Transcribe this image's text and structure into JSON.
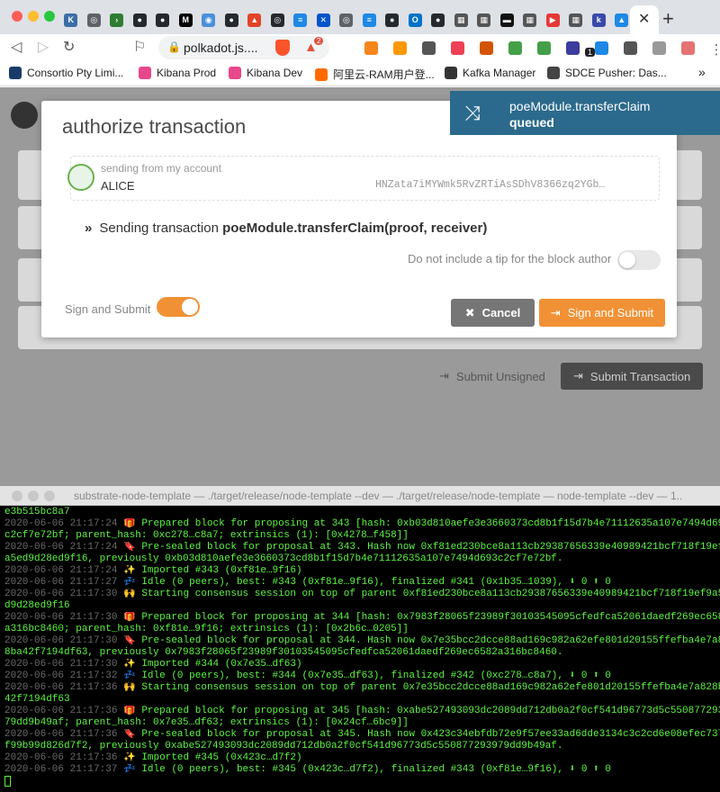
{
  "browser": {
    "tab_icons": [
      {
        "name": "tab-favicon-1",
        "color": "#3b6ea5",
        "glyph": "K"
      },
      {
        "name": "tab-favicon-2",
        "color": "#5f6368",
        "glyph": "◎"
      },
      {
        "name": "tab-favicon-3",
        "color": "#2e7d32",
        "glyph": "›"
      },
      {
        "name": "tab-favicon-4",
        "color": "#24292e",
        "glyph": "●"
      },
      {
        "name": "tab-favicon-5",
        "color": "#24292e",
        "glyph": "●"
      },
      {
        "name": "tab-favicon-6",
        "color": "#000000",
        "glyph": "M"
      },
      {
        "name": "tab-favicon-7",
        "color": "#4a90d9",
        "glyph": "◉"
      },
      {
        "name": "tab-favicon-8",
        "color": "#24292e",
        "glyph": "●"
      },
      {
        "name": "tab-favicon-9",
        "color": "#e24329",
        "glyph": "▲"
      },
      {
        "name": "tab-favicon-10",
        "color": "#24292e",
        "glyph": "◎"
      },
      {
        "name": "tab-favicon-11",
        "color": "#1e88e5",
        "glyph": "≡"
      },
      {
        "name": "tab-favicon-12",
        "color": "#0052cc",
        "glyph": "✕"
      },
      {
        "name": "tab-favicon-13",
        "color": "#5f6368",
        "glyph": "◎"
      },
      {
        "name": "tab-favicon-14",
        "color": "#1e88e5",
        "glyph": "≡"
      },
      {
        "name": "tab-favicon-15",
        "color": "#24292e",
        "glyph": "●"
      },
      {
        "name": "tab-favicon-16",
        "color": "#0072c6",
        "glyph": "O"
      },
      {
        "name": "tab-favicon-17",
        "color": "#24292e",
        "glyph": "●"
      },
      {
        "name": "tab-favicon-18",
        "color": "#555555",
        "glyph": "▦"
      },
      {
        "name": "tab-favicon-19",
        "color": "#555555",
        "glyph": "▦"
      },
      {
        "name": "tab-favicon-20",
        "color": "#111111",
        "glyph": "▬"
      },
      {
        "name": "tab-favicon-21",
        "color": "#555555",
        "glyph": "▦"
      },
      {
        "name": "tab-favicon-22",
        "color": "#e53935",
        "glyph": "▶"
      },
      {
        "name": "tab-favicon-23",
        "color": "#555555",
        "glyph": "▦"
      },
      {
        "name": "tab-favicon-24",
        "color": "#3949ab",
        "glyph": "k"
      },
      {
        "name": "tab-favicon-25",
        "color": "#1e88e5",
        "glyph": "▲"
      }
    ],
    "url": "polkadot.js....",
    "extensions": [
      {
        "name": "metamask-icon",
        "color": "#f6851b"
      },
      {
        "name": "rss-icon",
        "color": "#ff9800"
      },
      {
        "name": "eyedropper-icon",
        "color": "#555555"
      },
      {
        "name": "pocket-icon",
        "color": "#ef4056"
      },
      {
        "name": "ni-icon",
        "color": "#d35400"
      },
      {
        "name": "shield-icon",
        "color": "#43a047"
      },
      {
        "name": "refresh-icon",
        "color": "#43a047"
      },
      {
        "name": "ethereum-icon",
        "color": "#3c3c9c"
      },
      {
        "name": "polkadot-ext-icon",
        "color": "#1e88e5"
      },
      {
        "name": "s-icon",
        "color": "#555555"
      },
      {
        "name": "circle-icon",
        "color": "#999999"
      },
      {
        "name": "record-icon",
        "color": "#e57373"
      },
      {
        "name": "menu-dots-icon",
        "color": "#555555"
      }
    ],
    "badge_count": "1",
    "brave_badge": "2",
    "bookmarks": [
      {
        "label": "Consortio Pty Limi...",
        "color": "#1a3a6a"
      },
      {
        "label": "Kibana Prod",
        "color": "#e8478b"
      },
      {
        "label": "Kibana Dev",
        "color": "#e8478b"
      },
      {
        "label": "阿里云-RAM用户登...",
        "color": "#ff6a00"
      },
      {
        "label": "Kafka Manager",
        "color": "#333333"
      },
      {
        "label": "SDCE Pusher: Das...",
        "color": "#444444"
      }
    ],
    "more_bookmarks": "»"
  },
  "modal": {
    "title": "authorize transaction",
    "account_label": "sending from my account",
    "account_name": "ALICE",
    "account_address": "HNZata7iMYWmk5RvZRTiAsSDhV8366zq2YGb…",
    "sending_prefix": "Sending transaction ",
    "sending_call": "poeModule.transferClaim(proof, receiver)",
    "tip_label": "Do not include a tip for the block author",
    "sign_label": "Sign and Submit",
    "cancel_label": "Cancel",
    "sign_submit_label": "Sign and Submit"
  },
  "status": {
    "method": "poeModule.transferClaim",
    "state": "queued"
  },
  "page": {
    "submit_unsigned": "Submit Unsigned",
    "submit_transaction": "Submit Transaction"
  },
  "terminal": {
    "title": "substrate-node-template — ./target/release/node-template --dev — ./target/release/node-template — node-template --dev — 1..",
    "lines": [
      {
        "ts": "",
        "text": "e3b515bc8a7"
      },
      {
        "ts": "2020-06-06 21:17:24 ",
        "text": "🎁 Prepared block for proposing at 343 [hash: 0xb03d810aefe3e3660373cd8b1f15d7b4e71112635a107e7494d693"
      },
      {
        "ts": "",
        "text": "c2cf7e72bf; parent_hash: 0xc278…c8a7; extrinsics (1): [0x4278…f458]]"
      },
      {
        "ts": "2020-06-06 21:17:24 ",
        "text": "🔖 Pre-sealed block for proposal at 343. Hash now 0xf81ed230bce8a113cb29387656339e40989421bcf718f19ef9"
      },
      {
        "ts": "",
        "text": "a5ed9d28ed9f16, previously 0xb03d810aefe3e3660373cd8b1f15d7b4e71112635a107e7494d693c2cf7e72bf."
      },
      {
        "ts": "2020-06-06 21:17:24 ",
        "text": "✨ Imported #343 (0xf81e…9f16)"
      },
      {
        "ts": "2020-06-06 21:17:27 ",
        "text": "💤 Idle (0 peers), best: #343 (0xf81e…9f16), finalized #341 (0x1b35…1039), ⬇ 0 ⬆ 0"
      },
      {
        "ts": "2020-06-06 21:17:30 ",
        "text": "🙌 Starting consensus session on top of parent 0xf81ed230bce8a113cb29387656339e40989421bcf718f19ef9a5e"
      },
      {
        "ts": "",
        "text": "d9d28ed9f16"
      },
      {
        "ts": "2020-06-06 21:17:30 ",
        "text": "🎁 Prepared block for proposing at 344 [hash: 0x7983f28065f23989f30103545095cfedfca52061daedf269ec6582"
      },
      {
        "ts": "",
        "text": "a316bc8460; parent_hash: 0xf81e…9f16; extrinsics (1): [0x2b6c…0205]]"
      },
      {
        "ts": "2020-06-06 21:17:30 ",
        "text": "🔖 Pre-sealed block for proposal at 344. Hash now 0x7e35bcc2dcce88ad169c982a62efe801d20155ffefba4e7a82"
      },
      {
        "ts": "",
        "text": "8ba42f7194df63, previously 0x7983f28065f23989f30103545095cfedfca52061daedf269ec6582a316bc8460."
      },
      {
        "ts": "2020-06-06 21:17:30 ",
        "text": "✨ Imported #344 (0x7e35…df63)"
      },
      {
        "ts": "2020-06-06 21:17:32 ",
        "text": "💤 Idle (0 peers), best: #344 (0x7e35…df63), finalized #342 (0xc278…c8a7), ⬇ 0 ⬆ 0"
      },
      {
        "ts": "2020-06-06 21:17:36 ",
        "text": "🙌 Starting consensus session on top of parent 0x7e35bcc2dcce88ad169c982a62efe801d20155ffefba4e7a828ba"
      },
      {
        "ts": "",
        "text": "42f7194df63"
      },
      {
        "ts": "2020-06-06 21:17:36 ",
        "text": "🎁 Prepared block for proposing at 345 [hash: 0xabe527493093dc2089dd712db0a2f0cf541d96773d5c5508772939"
      },
      {
        "ts": "",
        "text": "79dd9b49af; parent_hash: 0x7e35…df63; extrinsics (1): [0x24cf…6bc9]]"
      },
      {
        "ts": "2020-06-06 21:17:36 ",
        "text": "🔖 Pre-sealed block for proposal at 345. Hash now 0x423c34ebfdb72e9f57ee33ad6dde3134c3c2cd6e08efec7370"
      },
      {
        "ts": "",
        "text": "f99b99d826d7f2, previously 0xabe527493093dc2089dd712db0a2f0cf541d96773d5c550877293979dd9b49af."
      },
      {
        "ts": "2020-06-06 21:17:36 ",
        "text": "✨ Imported #345 (0x423c…d7f2)"
      },
      {
        "ts": "2020-06-06 21:17:37 ",
        "text": "💤 Idle (0 peers), best: #345 (0x423c…d7f2), finalized #343 (0xf81e…9f16), ⬇ 0 ⬆ 0"
      }
    ]
  },
  "colors": {
    "accent": "#f19135",
    "status_bg": "#2b6a8c",
    "terminal_text": "#5cf542"
  }
}
